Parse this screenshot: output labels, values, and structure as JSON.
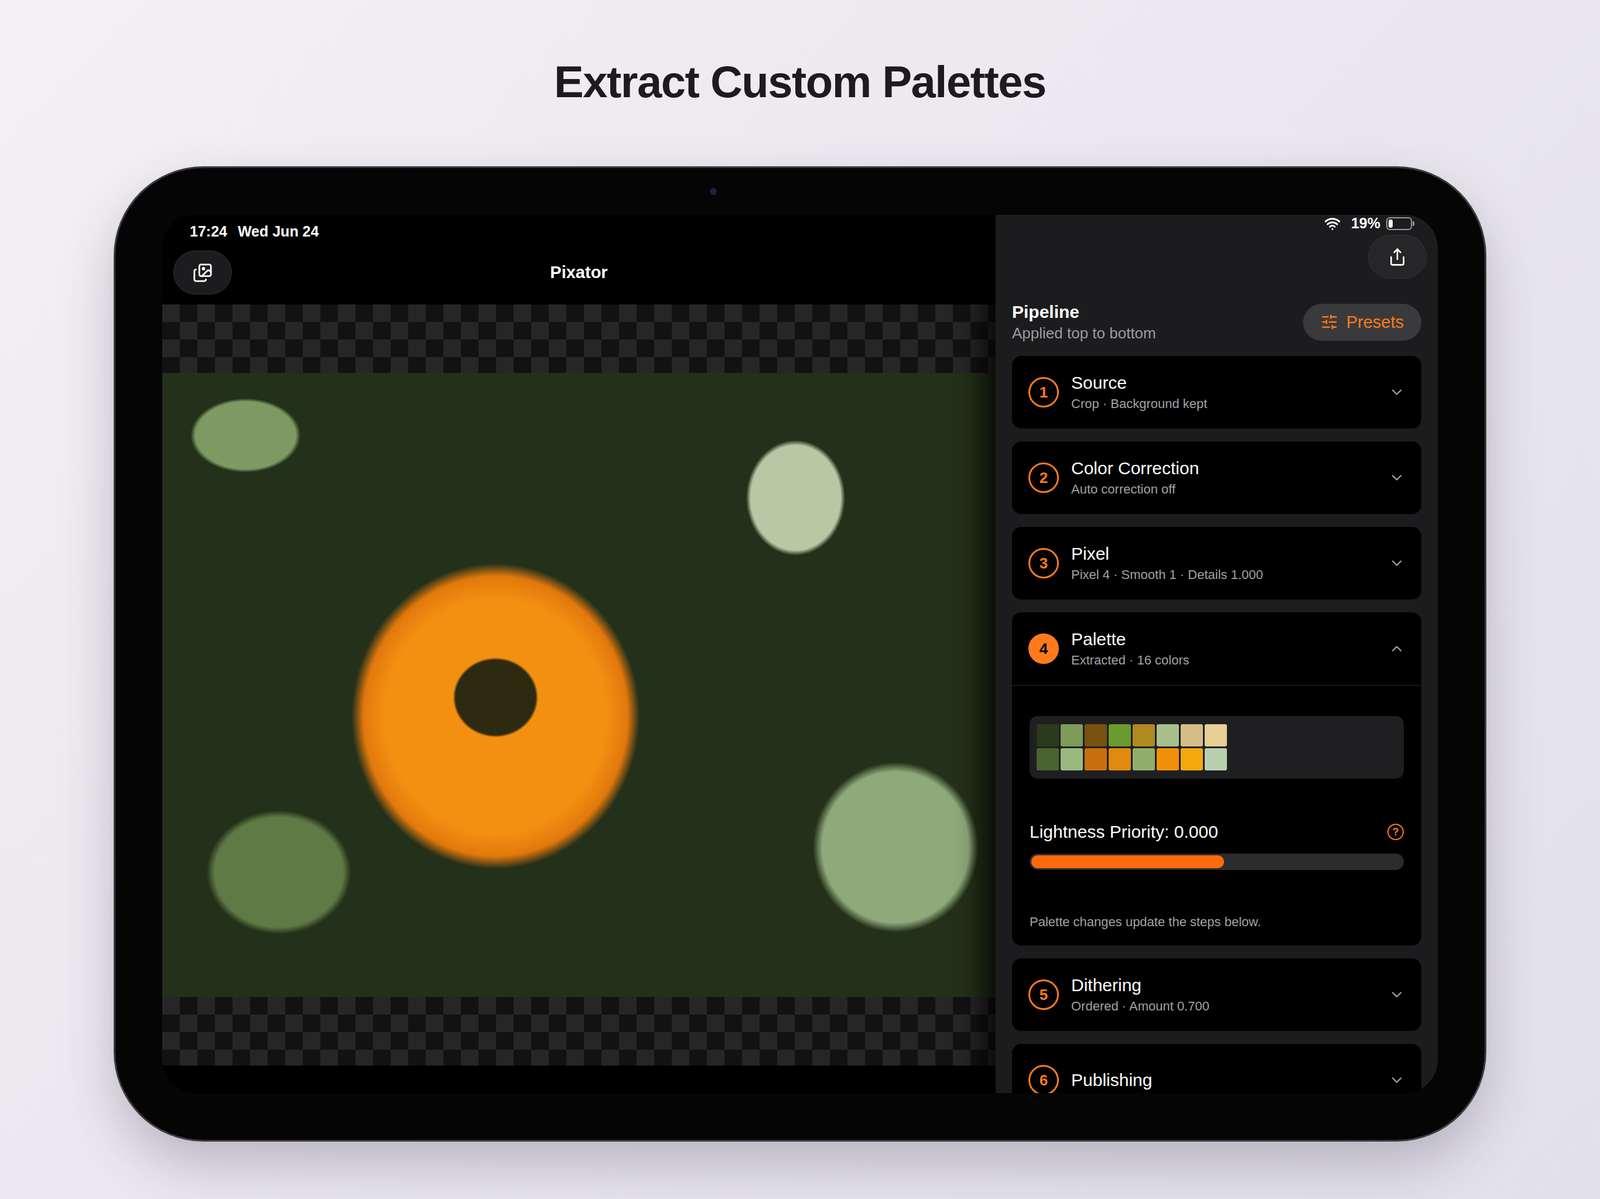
{
  "headline": "Extract Custom Palettes",
  "status_bar": {
    "time": "17:24",
    "date": "Wed Jun 24",
    "battery": "19%",
    "battery_level": 0.19
  },
  "toolbar": {
    "title": "Pixator"
  },
  "pipeline": {
    "title": "Pipeline",
    "subtitle": "Applied top to bottom",
    "presets_label": "Presets"
  },
  "steps": [
    {
      "number": "1",
      "title": "Source",
      "summary": "Crop · Background kept",
      "expanded": false
    },
    {
      "number": "2",
      "title": "Color Correction",
      "summary": "Auto correction off",
      "expanded": false
    },
    {
      "number": "3",
      "title": "Pixel",
      "summary": "Pixel 4 · Smooth 1 · Details 1.000",
      "expanded": false
    },
    {
      "number": "4",
      "title": "Palette",
      "summary": "Extracted · 16 colors",
      "expanded": true
    },
    {
      "number": "5",
      "title": "Dithering",
      "summary": "Ordered · Amount 0.700",
      "expanded": false
    },
    {
      "number": "6",
      "title": "Publishing",
      "summary": "",
      "expanded": false
    }
  ],
  "palette": {
    "swatches": [
      {
        "color": "#2b3a1a"
      },
      {
        "color": "#7f9a5a"
      },
      {
        "color": "#7a5210"
      },
      {
        "color": "#6b9a2e"
      },
      {
        "color": "#b08a20"
      },
      {
        "color": "#a9c08d"
      },
      {
        "color": "#d6bd88"
      },
      {
        "color": "#e8cf95"
      },
      {
        "color": "#4a6330"
      },
      {
        "color": "#9ab97f"
      },
      {
        "color": "#c8700f"
      },
      {
        "color": "#e08a10"
      },
      {
        "color": "#93ae6c"
      },
      {
        "color": "#f3900a"
      },
      {
        "color": "#f5a90f"
      },
      {
        "color": "#b8cfb0"
      }
    ],
    "slider": {
      "label": "Lightness Priority: 0.000",
      "level": 0.52
    },
    "help": "?",
    "note": "Palette changes update the steps below."
  }
}
